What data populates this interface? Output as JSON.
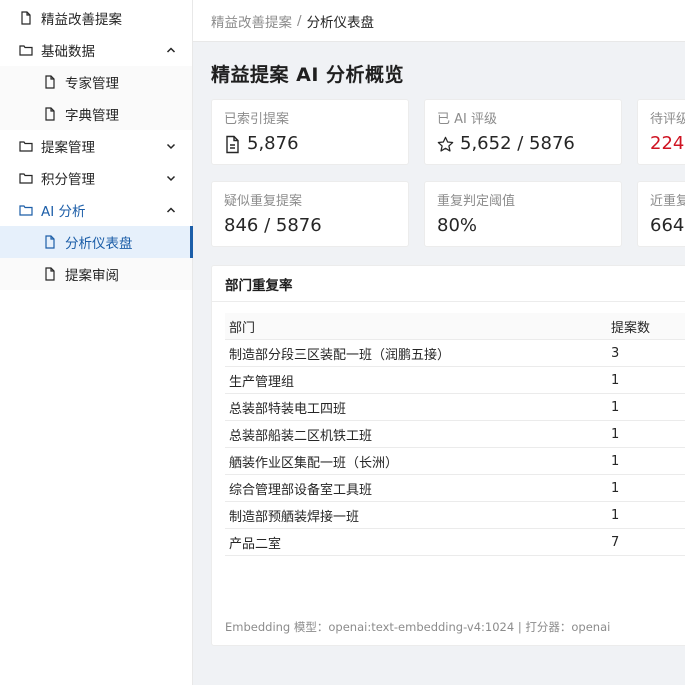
{
  "sidebar": {
    "items": [
      {
        "label": "精益改善提案",
        "icon": "file-icon",
        "level": 1
      },
      {
        "label": "基础数据",
        "icon": "folder-icon",
        "level": 1,
        "expanded": true
      },
      {
        "label": "专家管理",
        "icon": "file-icon",
        "level": 2
      },
      {
        "label": "字典管理",
        "icon": "file-icon",
        "level": 2
      },
      {
        "label": "提案管理",
        "icon": "folder-icon",
        "level": 1,
        "expanded": false
      },
      {
        "label": "积分管理",
        "icon": "folder-icon",
        "level": 1,
        "expanded": false
      },
      {
        "label": "AI 分析",
        "icon": "folder-icon",
        "level": 1,
        "expanded": true
      },
      {
        "label": "分析仪表盘",
        "icon": "file-icon",
        "level": 2,
        "active": true
      },
      {
        "label": "提案审阅",
        "icon": "file-icon",
        "level": 2
      }
    ]
  },
  "breadcrumb": {
    "parent": "精益改善提案",
    "separator": "/",
    "current": "分析仪表盘"
  },
  "page": {
    "title": "精益提案 AI 分析概览"
  },
  "stats": [
    {
      "label": "已索引提案",
      "value": "5,876",
      "icon": "document-icon"
    },
    {
      "label": "已 AI 评级",
      "value": "5,652 / 5876",
      "icon": "star-icon"
    },
    {
      "label": "待评级",
      "value": "224",
      "color": "#cf1322"
    },
    {
      "label": "疑似重复提案",
      "value": "846 / 5876"
    },
    {
      "label": "重复判定阈值",
      "value": "80%"
    },
    {
      "label": "近重复",
      "value": "664"
    }
  ],
  "dept_panel": {
    "title": "部门重复率",
    "columns": [
      "部门",
      "提案数"
    ],
    "rows": [
      [
        "制造部分段三区装配一班（润鹏五接）",
        "3"
      ],
      [
        "生产管理组",
        "1"
      ],
      [
        "总装部特装电工四班",
        "1"
      ],
      [
        "总装部船装二区机铁工班",
        "1"
      ],
      [
        "舾装作业区集配一班（长洲）",
        "1"
      ],
      [
        "综合管理部设备室工具班",
        "1"
      ],
      [
        "制造部预舾装焊接一班",
        "1"
      ],
      [
        "产品二室",
        "7"
      ]
    ],
    "footer": "Embedding 模型：openai:text-embedding-v4:1024  |  打分器：openai"
  },
  "colors": {
    "accent": "#1c5ea8",
    "danger": "#cf1322",
    "active_bg": "#e6f0fb"
  }
}
